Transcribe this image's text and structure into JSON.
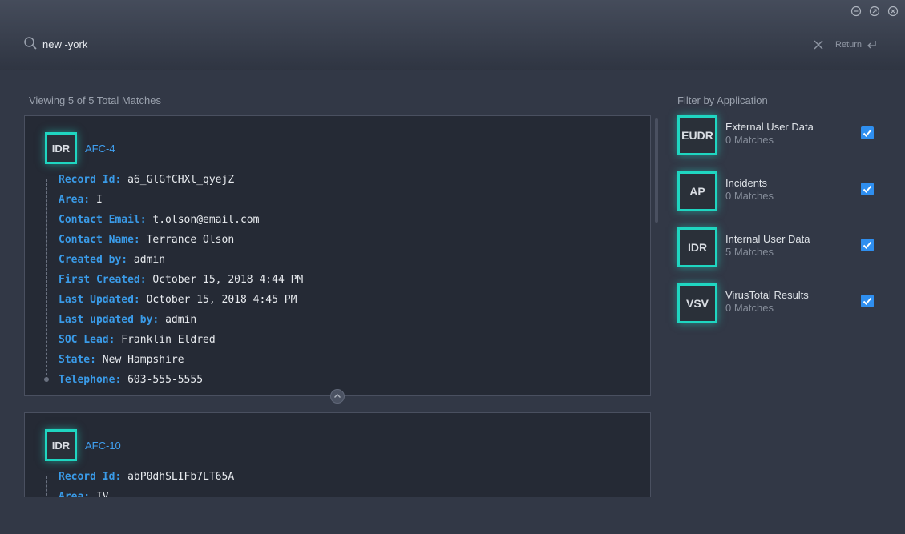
{
  "search": {
    "query": "new -york",
    "return_label": "Return"
  },
  "results": {
    "summary": "Viewing 5 of 5 Total Matches",
    "cards": [
      {
        "badge": "IDR",
        "title": "AFC-4",
        "fields": [
          {
            "key": "Record Id:",
            "value": "a6_GlGfCHXl_qyejZ"
          },
          {
            "key": "Area:",
            "value": "I"
          },
          {
            "key": "Contact Email:",
            "value": "t.olson@email.com"
          },
          {
            "key": "Contact Name:",
            "value": "Terrance Olson"
          },
          {
            "key": "Created by:",
            "value": "admin"
          },
          {
            "key": "First Created:",
            "value": "October 15, 2018 4:44 PM"
          },
          {
            "key": "Last Updated:",
            "value": "October 15, 2018 4:45 PM"
          },
          {
            "key": "Last updated by:",
            "value": "admin"
          },
          {
            "key": "SOC Lead:",
            "value": "Franklin Eldred"
          },
          {
            "key": "State:",
            "value": "New Hampshire"
          },
          {
            "key": "Telephone:",
            "value": "603-555-5555"
          }
        ]
      },
      {
        "badge": "IDR",
        "title": "AFC-10",
        "fields": [
          {
            "key": "Record Id:",
            "value": "abP0dhSLIFb7LT65A"
          },
          {
            "key": "Area:",
            "value": "IV"
          }
        ]
      }
    ]
  },
  "filter": {
    "title": "Filter by Application",
    "apps": [
      {
        "badge": "EUDR",
        "name": "External User Data",
        "count": "0 Matches",
        "checked": true
      },
      {
        "badge": "AP",
        "name": "Incidents",
        "count": "0 Matches",
        "checked": true
      },
      {
        "badge": "IDR",
        "name": "Internal User Data",
        "count": "5 Matches",
        "checked": true
      },
      {
        "badge": "VSV",
        "name": "VirusTotal Results",
        "count": "0 Matches",
        "checked": true
      }
    ]
  },
  "colors": {
    "accent": "#1fd6c1",
    "link": "#3f9ff0",
    "field_key": "#3a9be8",
    "checkbox": "#2f8ff0"
  }
}
